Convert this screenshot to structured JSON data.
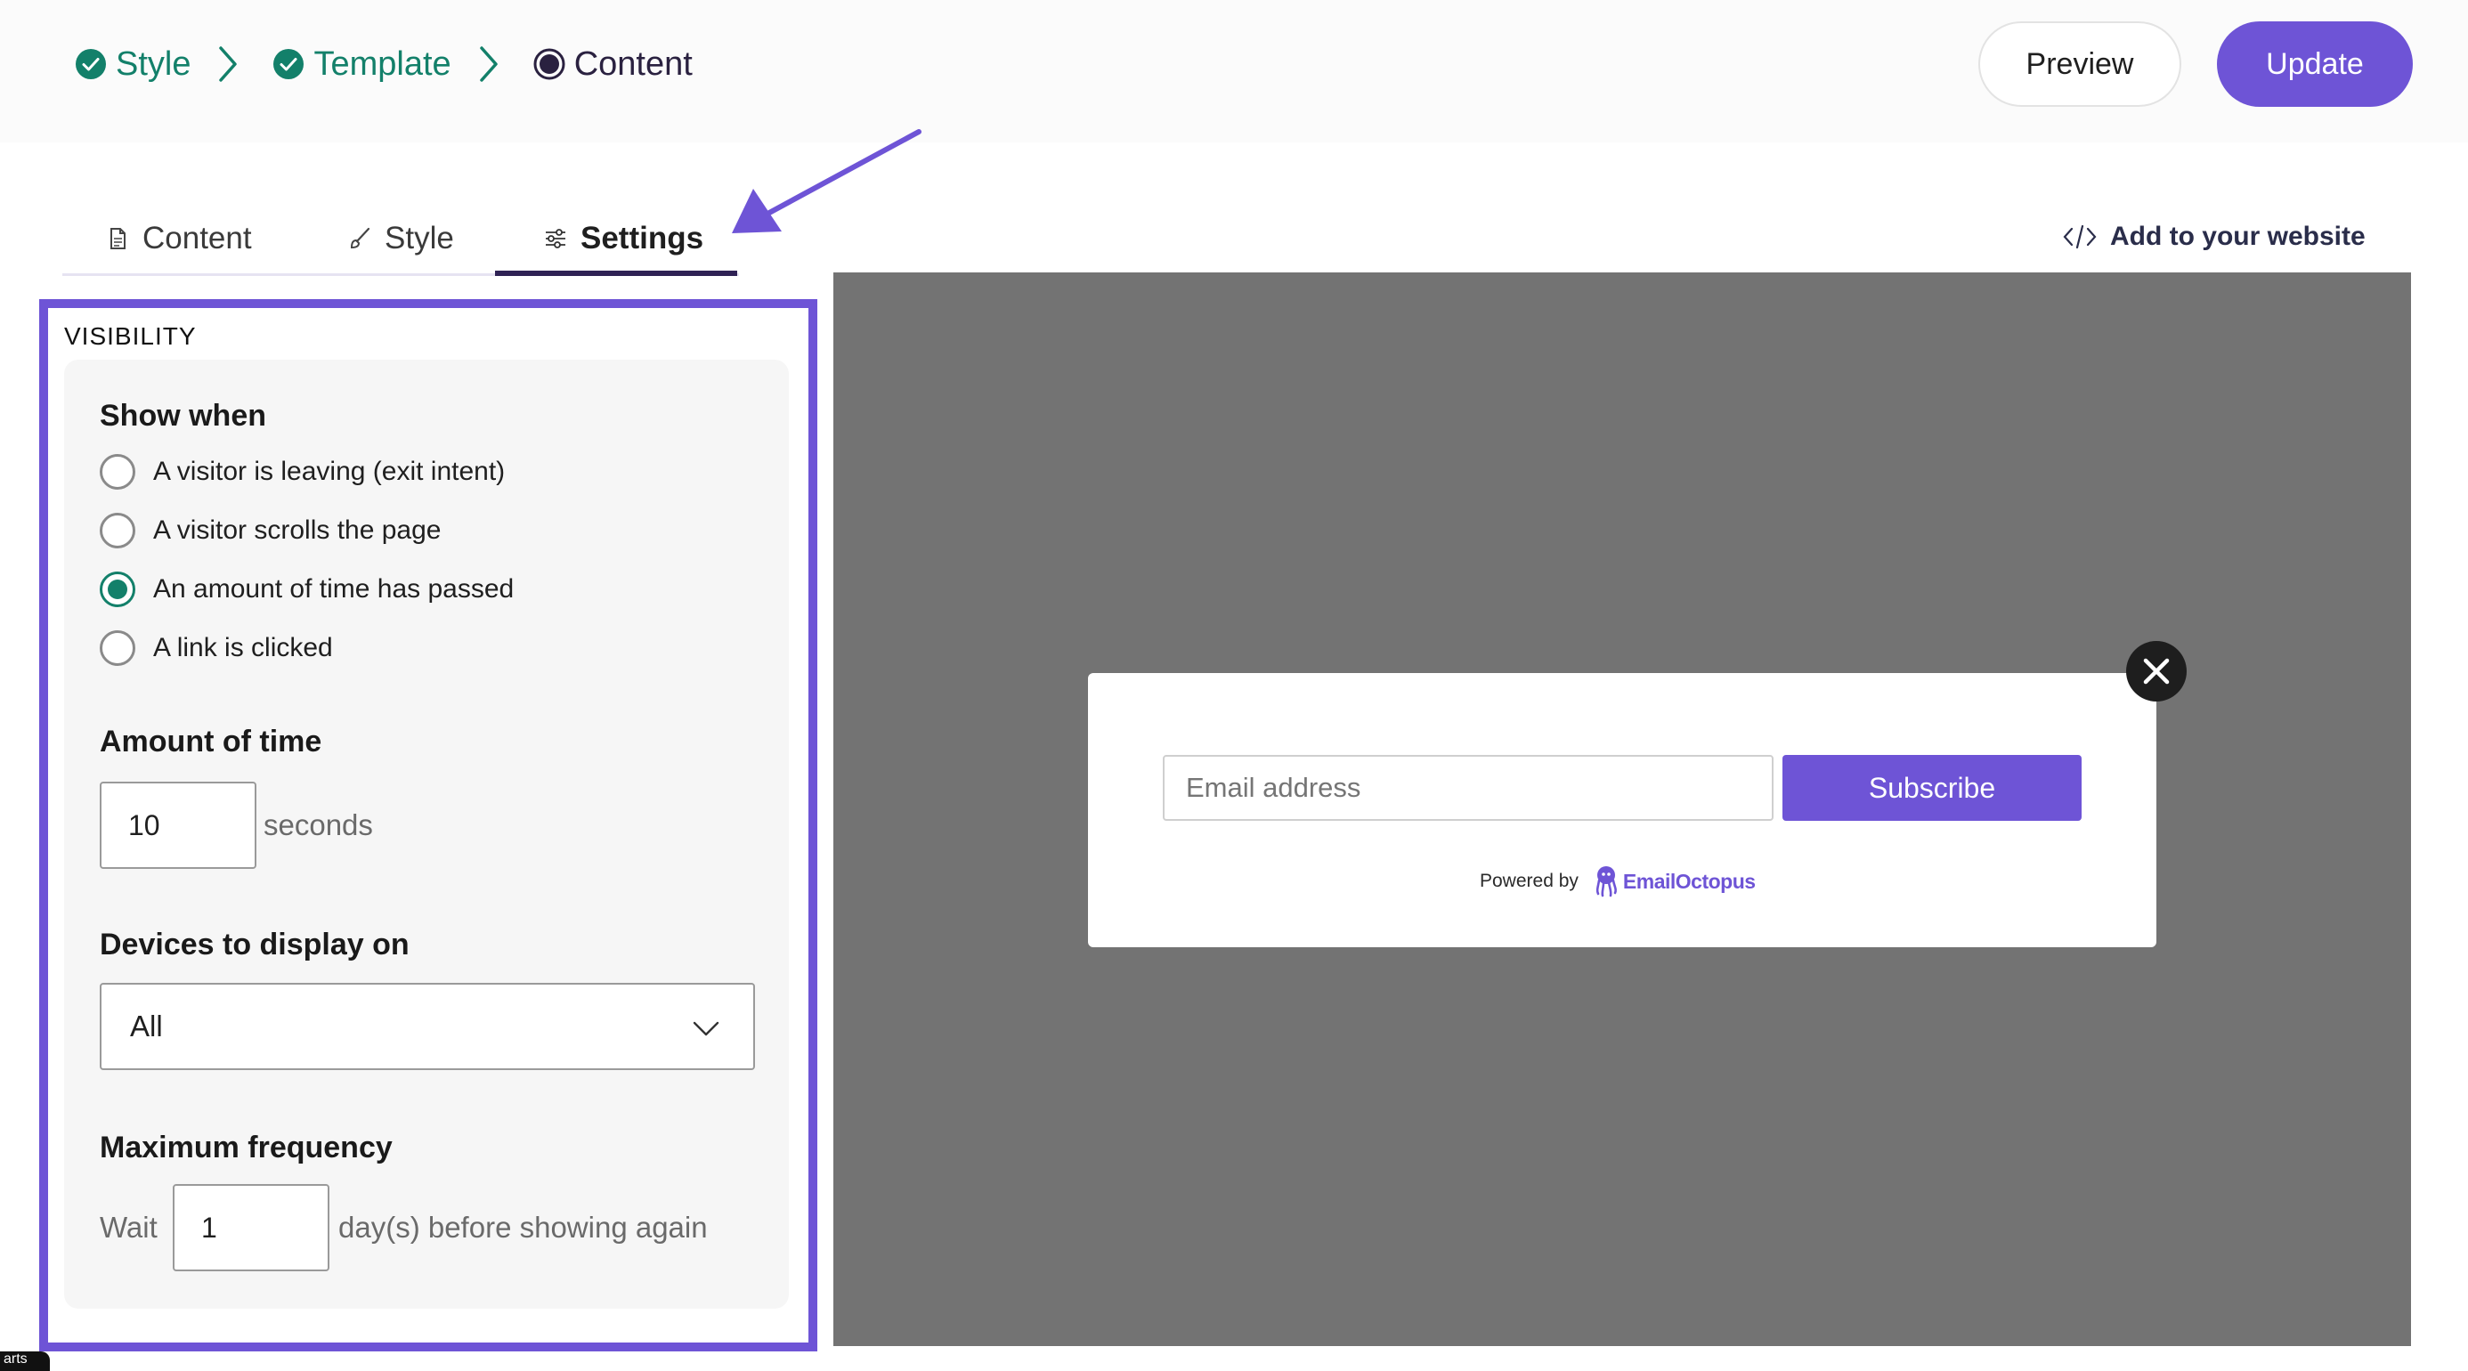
{
  "breadcrumb": {
    "steps": [
      {
        "label": "Style",
        "state": "done"
      },
      {
        "label": "Template",
        "state": "done"
      },
      {
        "label": "Content",
        "state": "current"
      }
    ]
  },
  "header": {
    "preview_label": "Preview",
    "update_label": "Update"
  },
  "tabs": [
    {
      "label": "Content",
      "icon": "document-icon"
    },
    {
      "label": "Style",
      "icon": "brush-icon"
    },
    {
      "label": "Settings",
      "icon": "sliders-icon",
      "active": true
    }
  ],
  "add_to_website": {
    "label": "Add to your website",
    "icon": "code-icon"
  },
  "settings": {
    "section_title": "VISIBILITY",
    "show_when": {
      "title": "Show when",
      "options": [
        {
          "label": "A visitor is leaving (exit intent)",
          "checked": false
        },
        {
          "label": "A visitor scrolls the page",
          "checked": false
        },
        {
          "label": "An amount of time has passed",
          "checked": true
        },
        {
          "label": "A link is clicked",
          "checked": false
        }
      ]
    },
    "amount_of_time": {
      "title": "Amount of time",
      "value": "10",
      "unit": "seconds"
    },
    "devices": {
      "title": "Devices to display on",
      "selected": "All"
    },
    "max_frequency": {
      "title": "Maximum frequency",
      "prefix": "Wait",
      "value": "1",
      "suffix": "day(s) before showing again"
    }
  },
  "popup": {
    "email_placeholder": "Email address",
    "subscribe_label": "Subscribe",
    "powered_by": "Powered by",
    "brand": "EmailOctopus"
  },
  "corner_chip": "arts",
  "colors": {
    "accent": "#6e54d6",
    "success": "#13806a",
    "preview_bg": "#737373",
    "tab_underline": "#2f2254"
  }
}
